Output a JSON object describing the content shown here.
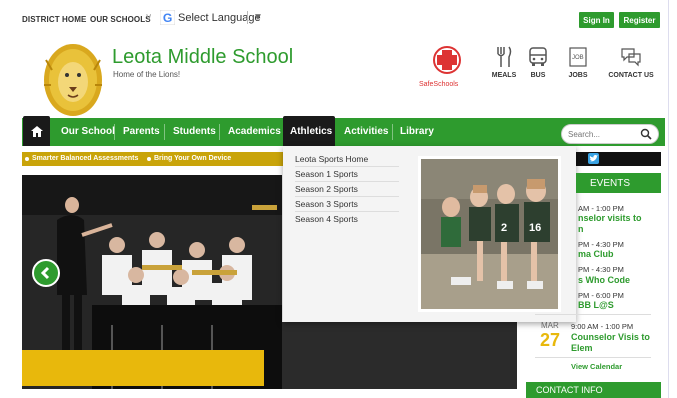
{
  "topbar": {
    "district_home": "DISTRICT HOME",
    "our_schools": "OUR SCHOOLS",
    "select_language": "Select Language",
    "sign_in": "Sign In",
    "register": "Register"
  },
  "header": {
    "school_name": "Leota Middle School",
    "tagline": "Home of the Lions!",
    "safeschools": "SafeSchools",
    "icons": [
      {
        "label": "MEALS",
        "icon": "meals-icon"
      },
      {
        "label": "BUS",
        "icon": "bus-icon"
      },
      {
        "label": "JOBS",
        "icon": "jobs-icon"
      },
      {
        "label": "CONTACT US",
        "icon": "contact-icon"
      }
    ]
  },
  "nav": {
    "items": [
      "Our School",
      "Parents",
      "Students",
      "Academics",
      "Athletics",
      "Activities",
      "Library"
    ],
    "active": "Athletics",
    "search_placeholder": "Search..."
  },
  "announcements": [
    "Smarter Balanced Assessments",
    "Bring Your Own Device"
  ],
  "dropdown": {
    "items": [
      "Leota Sports Home",
      "Season 1 Sports",
      "Season 2 Sports",
      "Season 3 Sports",
      "Season 4 Sports"
    ]
  },
  "events": {
    "heading": "EVENTS",
    "list": [
      {
        "time": "AM - 1:00 PM",
        "title_lines": [
          "nselor visits to",
          "n"
        ]
      },
      {
        "time": "PM - 4:30 PM",
        "title_lines": [
          "ma Club"
        ]
      },
      {
        "time": "PM - 4:30 PM",
        "title_lines": [
          "s Who Code"
        ]
      },
      {
        "time": "PM - 6:00 PM",
        "title_lines": [
          "BB L@S"
        ]
      }
    ],
    "last": {
      "month": "MAR",
      "day": "27",
      "time": "9:00 AM - 1:00 PM",
      "title_lines": [
        "Counselor Visis to",
        "Elem"
      ]
    },
    "view_calendar": "View Calendar"
  },
  "contact": {
    "heading": "CONTACT INFO"
  },
  "colors": {
    "green": "#2e9b2e",
    "gold": "#e8b80c",
    "dark": "#1a1a1a"
  }
}
